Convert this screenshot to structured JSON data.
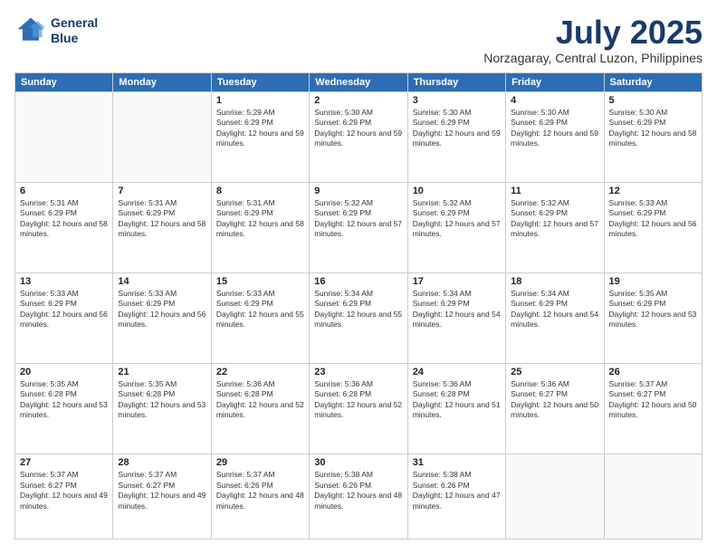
{
  "header": {
    "logo_line1": "General",
    "logo_line2": "Blue",
    "month": "July 2025",
    "location": "Norzagaray, Central Luzon, Philippines"
  },
  "weekdays": [
    "Sunday",
    "Monday",
    "Tuesday",
    "Wednesday",
    "Thursday",
    "Friday",
    "Saturday"
  ],
  "weeks": [
    [
      {
        "day": "",
        "info": ""
      },
      {
        "day": "",
        "info": ""
      },
      {
        "day": "1",
        "info": "Sunrise: 5:29 AM\nSunset: 6:29 PM\nDaylight: 12 hours and 59 minutes."
      },
      {
        "day": "2",
        "info": "Sunrise: 5:30 AM\nSunset: 6:29 PM\nDaylight: 12 hours and 59 minutes."
      },
      {
        "day": "3",
        "info": "Sunrise: 5:30 AM\nSunset: 6:29 PM\nDaylight: 12 hours and 59 minutes."
      },
      {
        "day": "4",
        "info": "Sunrise: 5:30 AM\nSunset: 6:29 PM\nDaylight: 12 hours and 59 minutes."
      },
      {
        "day": "5",
        "info": "Sunrise: 5:30 AM\nSunset: 6:29 PM\nDaylight: 12 hours and 58 minutes."
      }
    ],
    [
      {
        "day": "6",
        "info": "Sunrise: 5:31 AM\nSunset: 6:29 PM\nDaylight: 12 hours and 58 minutes."
      },
      {
        "day": "7",
        "info": "Sunrise: 5:31 AM\nSunset: 6:29 PM\nDaylight: 12 hours and 58 minutes."
      },
      {
        "day": "8",
        "info": "Sunrise: 5:31 AM\nSunset: 6:29 PM\nDaylight: 12 hours and 58 minutes."
      },
      {
        "day": "9",
        "info": "Sunrise: 5:32 AM\nSunset: 6:29 PM\nDaylight: 12 hours and 57 minutes."
      },
      {
        "day": "10",
        "info": "Sunrise: 5:32 AM\nSunset: 6:29 PM\nDaylight: 12 hours and 57 minutes."
      },
      {
        "day": "11",
        "info": "Sunrise: 5:32 AM\nSunset: 6:29 PM\nDaylight: 12 hours and 57 minutes."
      },
      {
        "day": "12",
        "info": "Sunrise: 5:33 AM\nSunset: 6:29 PM\nDaylight: 12 hours and 56 minutes."
      }
    ],
    [
      {
        "day": "13",
        "info": "Sunrise: 5:33 AM\nSunset: 6:29 PM\nDaylight: 12 hours and 56 minutes."
      },
      {
        "day": "14",
        "info": "Sunrise: 5:33 AM\nSunset: 6:29 PM\nDaylight: 12 hours and 56 minutes."
      },
      {
        "day": "15",
        "info": "Sunrise: 5:33 AM\nSunset: 6:29 PM\nDaylight: 12 hours and 55 minutes."
      },
      {
        "day": "16",
        "info": "Sunrise: 5:34 AM\nSunset: 6:29 PM\nDaylight: 12 hours and 55 minutes."
      },
      {
        "day": "17",
        "info": "Sunrise: 5:34 AM\nSunset: 6:29 PM\nDaylight: 12 hours and 54 minutes."
      },
      {
        "day": "18",
        "info": "Sunrise: 5:34 AM\nSunset: 6:29 PM\nDaylight: 12 hours and 54 minutes."
      },
      {
        "day": "19",
        "info": "Sunrise: 5:35 AM\nSunset: 6:29 PM\nDaylight: 12 hours and 53 minutes."
      }
    ],
    [
      {
        "day": "20",
        "info": "Sunrise: 5:35 AM\nSunset: 6:28 PM\nDaylight: 12 hours and 53 minutes."
      },
      {
        "day": "21",
        "info": "Sunrise: 5:35 AM\nSunset: 6:28 PM\nDaylight: 12 hours and 53 minutes."
      },
      {
        "day": "22",
        "info": "Sunrise: 5:36 AM\nSunset: 6:28 PM\nDaylight: 12 hours and 52 minutes."
      },
      {
        "day": "23",
        "info": "Sunrise: 5:36 AM\nSunset: 6:28 PM\nDaylight: 12 hours and 52 minutes."
      },
      {
        "day": "24",
        "info": "Sunrise: 5:36 AM\nSunset: 6:28 PM\nDaylight: 12 hours and 51 minutes."
      },
      {
        "day": "25",
        "info": "Sunrise: 5:36 AM\nSunset: 6:27 PM\nDaylight: 12 hours and 50 minutes."
      },
      {
        "day": "26",
        "info": "Sunrise: 5:37 AM\nSunset: 6:27 PM\nDaylight: 12 hours and 50 minutes."
      }
    ],
    [
      {
        "day": "27",
        "info": "Sunrise: 5:37 AM\nSunset: 6:27 PM\nDaylight: 12 hours and 49 minutes."
      },
      {
        "day": "28",
        "info": "Sunrise: 5:37 AM\nSunset: 6:27 PM\nDaylight: 12 hours and 49 minutes."
      },
      {
        "day": "29",
        "info": "Sunrise: 5:37 AM\nSunset: 6:26 PM\nDaylight: 12 hours and 48 minutes."
      },
      {
        "day": "30",
        "info": "Sunrise: 5:38 AM\nSunset: 6:26 PM\nDaylight: 12 hours and 48 minutes."
      },
      {
        "day": "31",
        "info": "Sunrise: 5:38 AM\nSunset: 6:26 PM\nDaylight: 12 hours and 47 minutes."
      },
      {
        "day": "",
        "info": ""
      },
      {
        "day": "",
        "info": ""
      }
    ]
  ]
}
